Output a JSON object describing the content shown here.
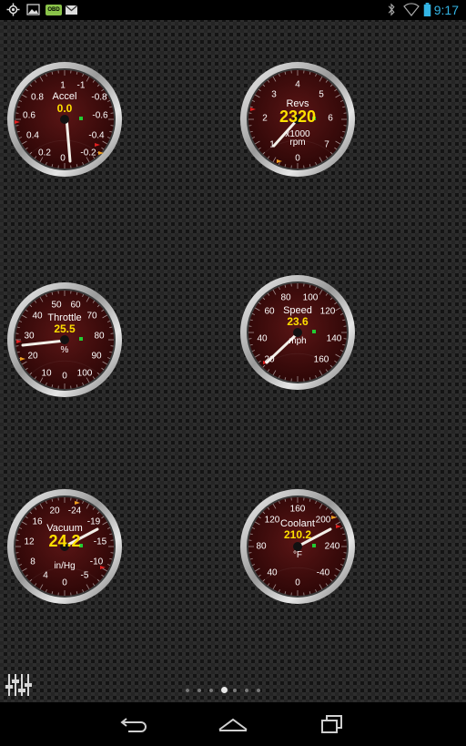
{
  "status_bar": {
    "time": "9:17",
    "left_icons": [
      "location-icon",
      "gallery-icon",
      "obd-icon",
      "gmail-icon"
    ],
    "right_icons": [
      "bluetooth-icon",
      "wifi-icon",
      "battery-icon"
    ],
    "obd_icon_text": "OBD"
  },
  "gauges": [
    {
      "id": "accel",
      "title": "Accel",
      "value": "0.0",
      "unit": "",
      "ticks": [
        "1",
        "0.8",
        "0.6",
        "0.4",
        "0.2",
        "0",
        "-1",
        "-0.8",
        "-0.6",
        "-0.4",
        "-0.2"
      ]
    },
    {
      "id": "revs",
      "title": "Revs",
      "value": "2320",
      "unit_line1": "x1000",
      "unit_line2": "rpm",
      "ticks": [
        "4",
        "3",
        "5",
        "2",
        "6",
        "1",
        "7",
        "0"
      ]
    },
    {
      "id": "throttle",
      "title": "Throttle",
      "value": "25.5",
      "unit": "%",
      "ticks": [
        "50",
        "60",
        "40",
        "70",
        "30",
        "80",
        "20",
        "90",
        "10",
        "100",
        "0"
      ]
    },
    {
      "id": "speed",
      "title": "Speed",
      "value": "23.6",
      "unit": "mph",
      "ticks": [
        "80",
        "100",
        "60",
        "120",
        "40",
        "140",
        "20",
        "160"
      ]
    },
    {
      "id": "vacuum",
      "title": "Vacuum",
      "value": "24.2",
      "unit": "in/Hg",
      "ticks": [
        "20",
        "-24",
        "16",
        "-19",
        "12",
        "-15",
        "8",
        "-10",
        "4",
        "-5",
        "0"
      ]
    },
    {
      "id": "coolant",
      "title": "Coolant",
      "value": "210.2",
      "unit": "°F",
      "ticks": [
        "160",
        "120",
        "200",
        "80",
        "240",
        "40",
        "-40",
        "0"
      ]
    }
  ],
  "page_indicator": {
    "count": 7,
    "active": 3
  },
  "nav": [
    "back-icon",
    "home-icon",
    "recents-icon"
  ],
  "colors": {
    "dial_face": "#4a0f0f",
    "value_yellow": "#ffe000",
    "accent_blue": "#33b5e5"
  }
}
